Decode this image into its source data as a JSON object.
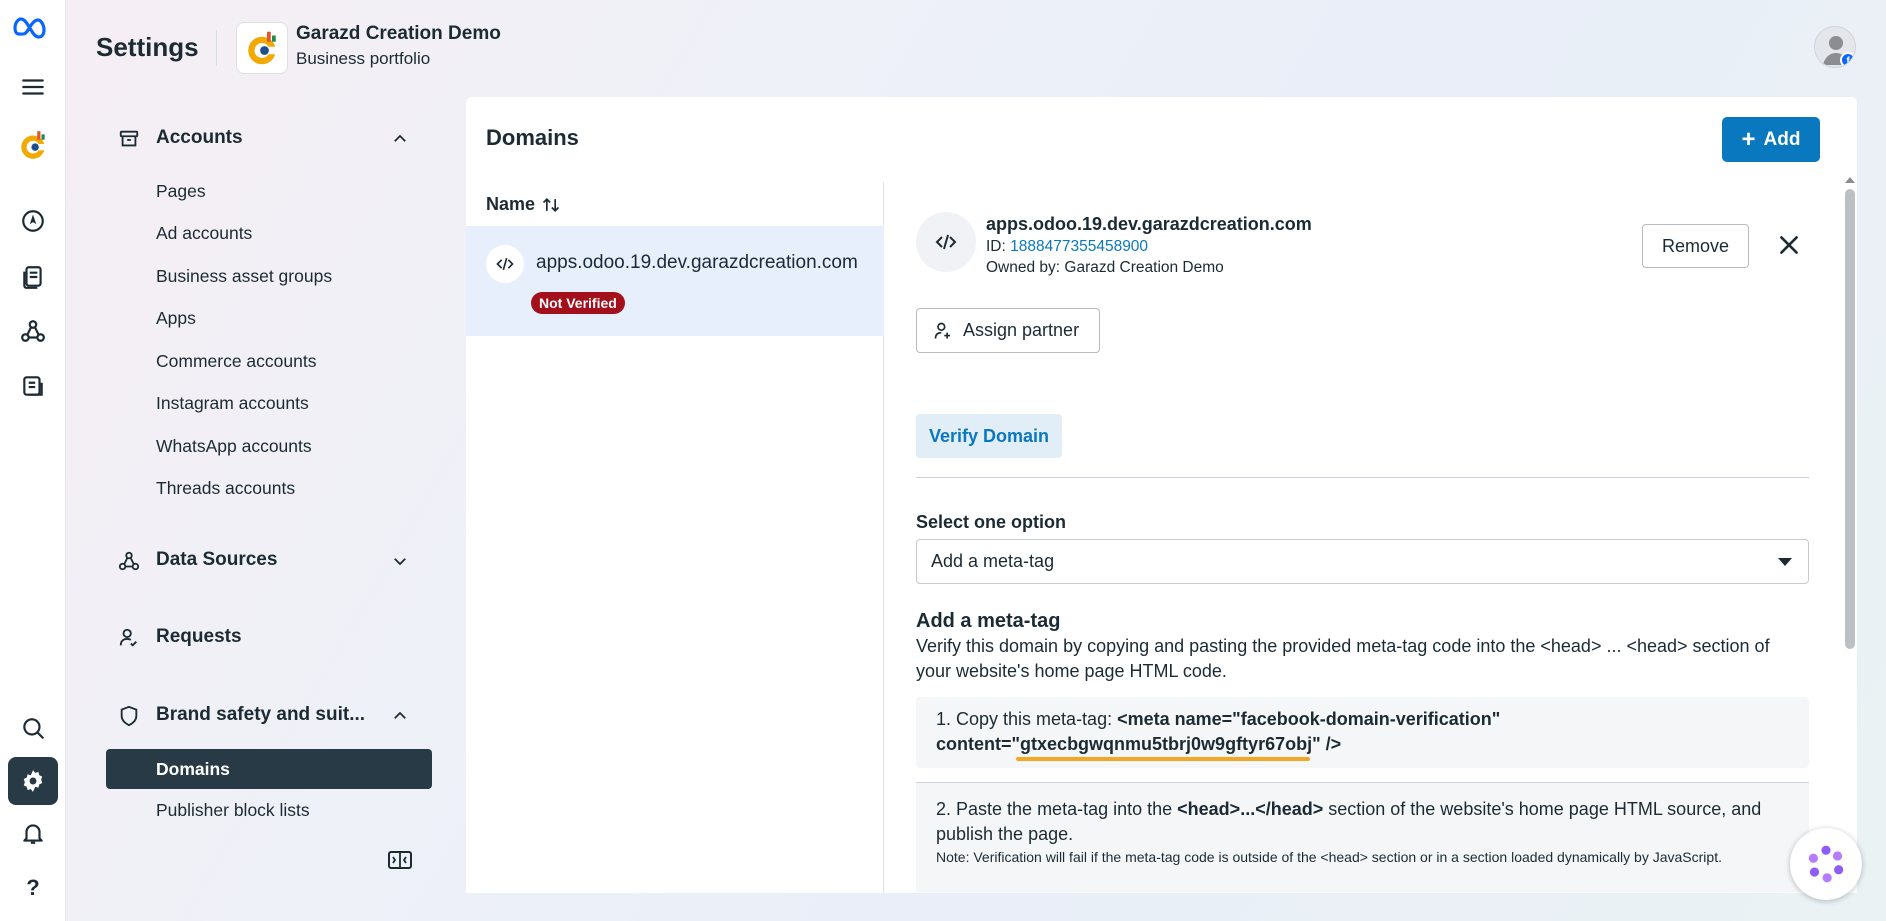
{
  "header": {
    "title": "Settings",
    "business_name": "Garazd Creation Demo",
    "business_subtitle": "Business portfolio"
  },
  "rail": {
    "icons": [
      "meta-logo-icon",
      "menu-icon",
      "business-logo-icon",
      "navigate-icon",
      "pages-icon",
      "integrations-icon",
      "billing-icon",
      "search-icon",
      "settings-icon",
      "notifications-icon",
      "help-icon"
    ],
    "help_label": "?"
  },
  "sidebar": {
    "accounts": {
      "label": "Accounts",
      "items": [
        "Pages",
        "Ad accounts",
        "Business asset groups",
        "Apps",
        "Commerce accounts",
        "Instagram accounts",
        "WhatsApp accounts",
        "Threads accounts"
      ]
    },
    "data_sources": {
      "label": "Data Sources"
    },
    "requests": {
      "label": "Requests"
    },
    "brand_safety": {
      "label": "Brand safety and suit...",
      "items": [
        "Domains",
        "Publisher block lists"
      ]
    }
  },
  "panel": {
    "title": "Domains",
    "add_label": "Add",
    "column_header": "Name",
    "rows": [
      {
        "domain": "apps.odoo.19.dev.garazdcreation.com",
        "status": "Not Verified"
      }
    ]
  },
  "detail": {
    "domain": "apps.odoo.19.dev.garazdcreation.com",
    "id_prefix": "ID: ",
    "id_value": "1888477355458900",
    "owned_by": "Owned by: Garazd Creation Demo",
    "remove_label": "Remove",
    "assign_label": "Assign partner",
    "verify_label": "Verify Domain",
    "select_label": "Select one option",
    "select_value": "Add a meta-tag",
    "method_title": "Add a meta-tag",
    "method_desc": "Verify this domain by copying and pasting the provided meta-tag code into the <head> ... <head> section of your website's home page HTML code.",
    "step1_prefix": "1. Copy this meta-tag: ",
    "step1_code_a": "<meta name=\"facebook-domain-verification\"",
    "step1_code_b": "content=\"gtxecbgwqnmu5tbrj0w9gftyr67obj\" />",
    "step2_prefix": "2. Paste the meta-tag into the ",
    "step2_code": "<head>...</head>",
    "step2_suffix": " section of the website's home page HTML source, and publish the page.",
    "step2_note": "Note: Verification will fail if the meta-tag code is outside of the <head> section or in a section loaded dynamically by JavaScript."
  },
  "colors": {
    "accent": "#0a78be",
    "active_nav": "#283a45",
    "badge_red": "#a3101c",
    "highlight": "#f5a623"
  }
}
